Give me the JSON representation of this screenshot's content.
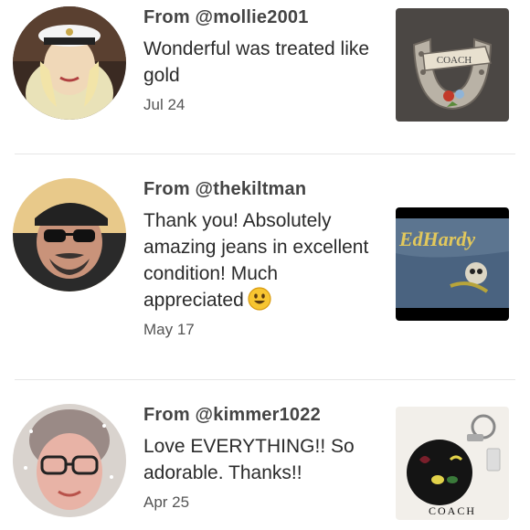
{
  "reviews": [
    {
      "from": "From @mollie2001",
      "message": "Wonderful was treated like gold",
      "date": "Jul 24",
      "avatar_icon": "user-avatar-photo",
      "thumbnail_icon": "coach-horseshoe-patch-image",
      "thumbnail_text": "COACH"
    },
    {
      "from": "From @thekiltman",
      "message": "Thank you! Absolutely amazing jeans in excellent condition! Much appreciated",
      "emoji": "smiley-emoji",
      "date": "May 17",
      "avatar_icon": "user-avatar-photo",
      "thumbnail_icon": "ed-hardy-jeans-image",
      "thumbnail_text": "EdHardy"
    },
    {
      "from": "From @kimmer1022",
      "message": "Love EVERYTHING!! So adorable. Thanks!!",
      "date": "Apr 25",
      "avatar_icon": "user-avatar-photo",
      "thumbnail_icon": "coach-keychain-image",
      "thumbnail_text": "COACH"
    }
  ]
}
